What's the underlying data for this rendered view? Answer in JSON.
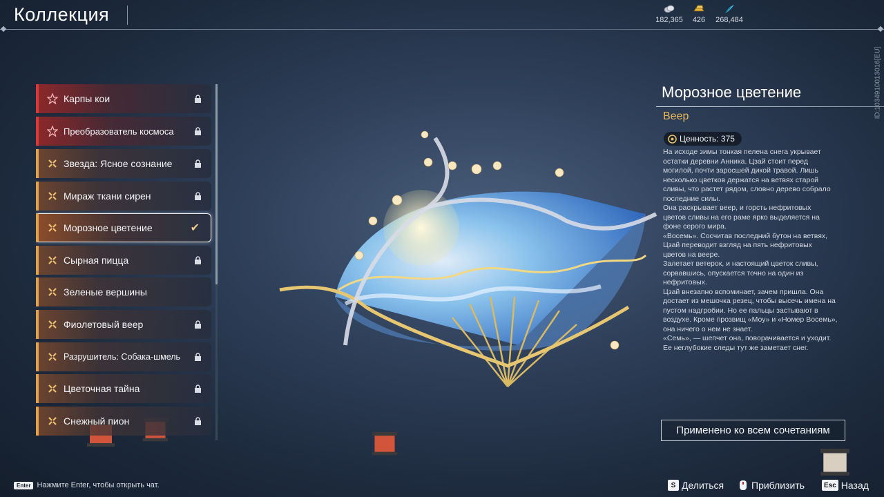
{
  "header": {
    "title": "Коллекция",
    "currencies": [
      {
        "icon": "silver-coins-icon",
        "amount": "182,365",
        "color": "#d9dde4"
      },
      {
        "icon": "gold-bars-icon",
        "amount": "426",
        "color": "#e5b43c"
      },
      {
        "icon": "blue-feather-icon",
        "amount": "268,484",
        "color": "#35b6d9"
      }
    ]
  },
  "player_id": "ID:1034910013016[EU]",
  "collection_list": [
    {
      "label": "Карпы кои",
      "rarity": "red",
      "state": "locked"
    },
    {
      "label": "Преобразователь космоса",
      "rarity": "red",
      "state": "locked"
    },
    {
      "label": "Звезда: Ясное сознание",
      "rarity": "gold",
      "state": "locked"
    },
    {
      "label": "Мираж ткани сирен",
      "rarity": "gold",
      "state": "locked"
    },
    {
      "label": "Морозное цветение",
      "rarity": "gold",
      "state": "equipped"
    },
    {
      "label": "Сырная пицца",
      "rarity": "gold",
      "state": "locked"
    },
    {
      "label": "Зеленые вершины",
      "rarity": "gold",
      "state": "unlocked"
    },
    {
      "label": "Фиолетовый веер",
      "rarity": "gold",
      "state": "locked"
    },
    {
      "label": "Разрушитель: Собака-шмель",
      "rarity": "gold",
      "state": "locked"
    },
    {
      "label": "Цветочная тайна",
      "rarity": "gold",
      "state": "locked"
    },
    {
      "label": "Снежный пион",
      "rarity": "gold",
      "state": "locked"
    }
  ],
  "detail": {
    "name": "Морозное цветение",
    "type": "Веер",
    "value_label": "Ценность: 375",
    "description": "На исходе зимы тонкая пелена снега укрывает\nостатки деревни Анника. Цзай стоит перед\nмогилой, почти заросшей дикой травой. Лишь\nнесколько цветков держатся на ветвях старой\nсливы, что растет рядом, словно дерево собрало\nпоследние силы.\nОна раскрывает веер, и горсть нефритовых\nцветов сливы на его раме ярко выделяется на\nфоне серого мира.\n«Восемь». Сосчитав последний бутон на ветвях,\nЦзай переводит взгляд на пять нефритовых\nцветов на веере.\nЗалетает ветерок, и настоящий цветок сливы,\nсорвавшись, опускается точно на один из\nнефритовых.\nЦзай внезапно вспоминает, зачем пришла. Она\nдостает из мешочка резец, чтобы высечь имена на\nпустом надгробии. Но ее пальцы застывают в\nвоздухе. Кроме прозвищ «Моу» и «Номер Восемь»,\nона ничего о нем не знает.\n«Семь», — шепчет она, поворачивается и уходит.\nЕе неглубокие следы тут же заметает снег.",
    "applied_button": "Применено ко всем сочетаниям"
  },
  "footer": {
    "chat_key": "Enter",
    "chat_hint": "Нажмите Enter, чтобы открыть чат.",
    "share_key": "S",
    "share_label": "Делиться",
    "zoom_label": "Приблизить",
    "back_key": "Esc",
    "back_label": "Назад"
  },
  "colors": {
    "accent_gold": "#e0a24a",
    "accent_red": "#d63a3a",
    "type_text": "#e8b95a"
  }
}
